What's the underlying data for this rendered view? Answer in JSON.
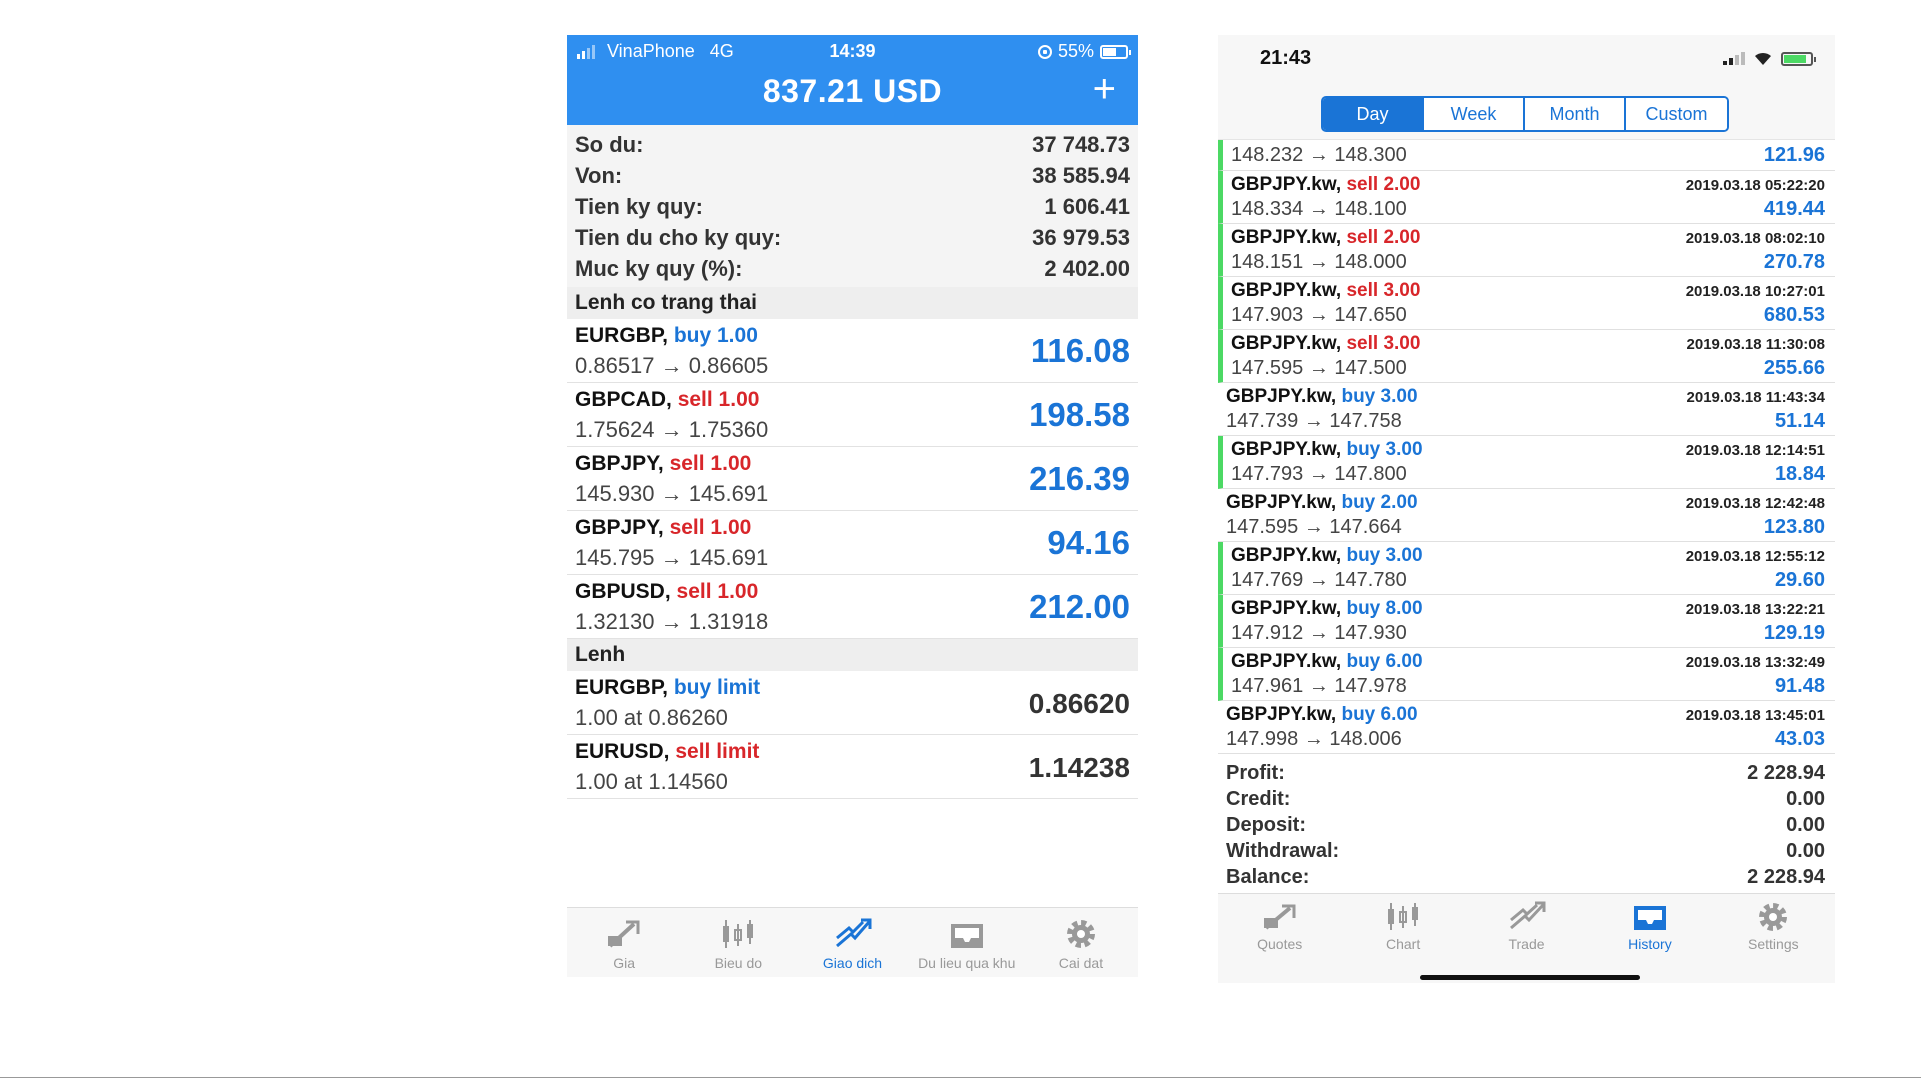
{
  "left": {
    "status": {
      "carrier": "VinaPhone",
      "network": "4G",
      "time": "14:39",
      "battery": "55%"
    },
    "header": {
      "balance": "837.21 USD",
      "add_label": "+"
    },
    "summary": [
      {
        "label": "So du:",
        "value": "37 748.73"
      },
      {
        "label": "Von:",
        "value": "38 585.94"
      },
      {
        "label": "Tien ky quy:",
        "value": "1 606.41"
      },
      {
        "label": "Tien du cho ky quy:",
        "value": "36 979.53"
      },
      {
        "label": "Muc ky quy (%):",
        "value": "2 402.00"
      }
    ],
    "open_section_title": "Lenh co trang thai",
    "positions": [
      {
        "symbol": "EURGBP,",
        "side": "buy 1.00",
        "prices": "0.86517 → 0.86605",
        "profit": "116.08"
      },
      {
        "symbol": "GBPCAD,",
        "side": "sell 1.00",
        "prices": "1.75624 → 1.75360",
        "profit": "198.58"
      },
      {
        "symbol": "GBPJPY,",
        "side": "sell 1.00",
        "prices": "145.930 → 145.691",
        "profit": "216.39"
      },
      {
        "symbol": "GBPJPY,",
        "side": "sell 1.00",
        "prices": "145.795 → 145.691",
        "profit": "94.16"
      },
      {
        "symbol": "GBPUSD,",
        "side": "sell 1.00",
        "prices": "1.32130 → 1.31918",
        "profit": "212.00"
      }
    ],
    "pending_section_title": "Lenh",
    "pending": [
      {
        "symbol": "EURGBP,",
        "side": "buy limit",
        "detail": "1.00 at 0.86260",
        "price": "0.86620"
      },
      {
        "symbol": "EURUSD,",
        "side": "sell limit",
        "detail": "1.00 at 1.14560",
        "price": "1.14238"
      }
    ],
    "tabs": [
      "Gia",
      "Bieu do",
      "Giao dich",
      "Du lieu qua khu",
      "Cai dat"
    ],
    "active_tab": "Giao dich"
  },
  "right": {
    "status": {
      "time": "21:43"
    },
    "segments": [
      "Day",
      "Week",
      "Month",
      "Custom"
    ],
    "active_segment": "Day",
    "partial_row": {
      "prices": "148.232 → 148.300",
      "profit": "121.96"
    },
    "deals": [
      {
        "symbol": "GBPJPY.kw,",
        "side": "sell 2.00",
        "time": "2019.03.18 05:22:20",
        "prices": "148.334 → 148.100",
        "profit": "419.44"
      },
      {
        "symbol": "GBPJPY.kw,",
        "side": "sell 2.00",
        "time": "2019.03.18 08:02:10",
        "prices": "148.151 → 148.000",
        "profit": "270.78"
      },
      {
        "symbol": "GBPJPY.kw,",
        "side": "sell 3.00",
        "time": "2019.03.18 10:27:01",
        "prices": "147.903 → 147.650",
        "profit": "680.53"
      },
      {
        "symbol": "GBPJPY.kw,",
        "side": "sell 3.00",
        "time": "2019.03.18 11:30:08",
        "prices": "147.595 → 147.500",
        "profit": "255.66"
      },
      {
        "symbol": "GBPJPY.kw,",
        "side": "buy 3.00",
        "time": "2019.03.18 11:43:34",
        "prices": "147.739 → 147.758",
        "profit": "51.14"
      },
      {
        "symbol": "GBPJPY.kw,",
        "side": "buy 3.00",
        "time": "2019.03.18 12:14:51",
        "prices": "147.793 → 147.800",
        "profit": "18.84"
      },
      {
        "symbol": "GBPJPY.kw,",
        "side": "buy 2.00",
        "time": "2019.03.18 12:42:48",
        "prices": "147.595 → 147.664",
        "profit": "123.80"
      },
      {
        "symbol": "GBPJPY.kw,",
        "side": "buy 3.00",
        "time": "2019.03.18 12:55:12",
        "prices": "147.769 → 147.780",
        "profit": "29.60"
      },
      {
        "symbol": "GBPJPY.kw,",
        "side": "buy 8.00",
        "time": "2019.03.18 13:22:21",
        "prices": "147.912 → 147.930",
        "profit": "129.19"
      },
      {
        "symbol": "GBPJPY.kw,",
        "side": "buy 6.00",
        "time": "2019.03.18 13:32:49",
        "prices": "147.961 → 147.978",
        "profit": "91.48"
      },
      {
        "symbol": "GBPJPY.kw,",
        "side": "buy 6.00",
        "time": "2019.03.18 13:45:01",
        "prices": "147.998 → 148.006",
        "profit": "43.03"
      }
    ],
    "totals": [
      {
        "label": "Profit:",
        "value": "2 228.94"
      },
      {
        "label": "Credit:",
        "value": "0.00"
      },
      {
        "label": "Deposit:",
        "value": "0.00"
      },
      {
        "label": "Withdrawal:",
        "value": "0.00"
      },
      {
        "label": "Balance:",
        "value": "2 228.94"
      }
    ],
    "tabs": [
      "Quotes",
      "Chart",
      "Trade",
      "History",
      "Settings"
    ],
    "active_tab": "History"
  },
  "colors": {
    "accent": "#2f8ff0",
    "buy": "#1a74d6",
    "sell": "#d8262a",
    "profit_marker": "#4cd964"
  }
}
